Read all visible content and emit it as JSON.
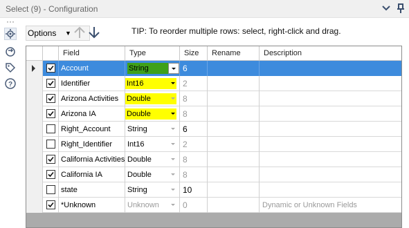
{
  "window": {
    "title": "Select (9) - Configuration"
  },
  "toolbar": {
    "options_label": "Options",
    "tip": "TIP: To reorder multiple rows: select, right-click and drag."
  },
  "grid": {
    "columns": [
      "Field",
      "Type",
      "Size",
      "Rename",
      "Description"
    ],
    "rows": [
      {
        "checked": true,
        "field": "Account",
        "type": "String",
        "size": "6",
        "rename": "",
        "description": "",
        "type_hl": "green",
        "size_dim": false,
        "dd_active": true
      },
      {
        "checked": true,
        "field": "Identifier",
        "type": "Int16",
        "size": "2",
        "rename": "",
        "description": "",
        "type_hl": "yellow",
        "size_dim": true,
        "dd_active": true
      },
      {
        "checked": true,
        "field": "Arizona Activities",
        "type": "Double",
        "size": "8",
        "rename": "",
        "description": "",
        "type_hl": "yellow",
        "size_dim": true,
        "dd_active": false
      },
      {
        "checked": true,
        "field": "Arizona IA",
        "type": "Double",
        "size": "8",
        "rename": "",
        "description": "",
        "type_hl": "yellow",
        "size_dim": true,
        "dd_active": true
      },
      {
        "checked": false,
        "field": "Right_Account",
        "type": "String",
        "size": "6",
        "rename": "",
        "description": "",
        "type_hl": "",
        "size_dim": false,
        "dd_active": false
      },
      {
        "checked": false,
        "field": "Right_Identifier",
        "type": "Int16",
        "size": "2",
        "rename": "",
        "description": "",
        "type_hl": "",
        "size_dim": true,
        "dd_active": false
      },
      {
        "checked": true,
        "field": "California Activities",
        "type": "Double",
        "size": "8",
        "rename": "",
        "description": "",
        "type_hl": "",
        "size_dim": true,
        "dd_active": false
      },
      {
        "checked": true,
        "field": "California IA",
        "type": "Double",
        "size": "8",
        "rename": "",
        "description": "",
        "type_hl": "",
        "size_dim": true,
        "dd_active": false
      },
      {
        "checked": false,
        "field": "state",
        "type": "String",
        "size": "10",
        "rename": "",
        "description": "",
        "type_hl": "",
        "size_dim": false,
        "dd_active": false
      },
      {
        "checked": true,
        "field": "*Unknown",
        "type": "Unknown",
        "size": "0",
        "rename": "",
        "description": "Dynamic or Unknown Fields",
        "type_hl": "",
        "size_dim": true,
        "dd_active": false
      }
    ]
  },
  "colors": {
    "selection": "#3d8bdd",
    "highlight_green": "#3fa11a",
    "highlight_yellow": "#ffff00",
    "grid_bg": "#ababab"
  },
  "icons": [
    "chevron-down-icon",
    "pin-icon",
    "configuration-icon",
    "connection-icon",
    "tag-icon",
    "help-icon",
    "move-up-icon",
    "move-down-icon"
  ]
}
